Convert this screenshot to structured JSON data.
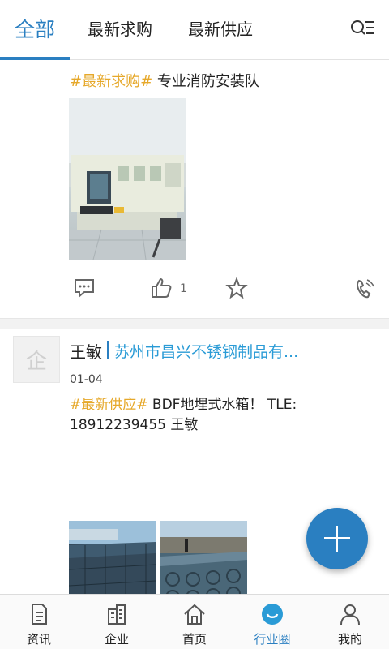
{
  "tabs": [
    {
      "label": "全部",
      "active": true
    },
    {
      "label": "最新求购",
      "active": false
    },
    {
      "label": "最新供应",
      "active": false
    }
  ],
  "posts": [
    {
      "tag": "#最新求购#",
      "text": "专业消防安装队",
      "like_count": "1"
    },
    {
      "author": "王敏",
      "company": "苏州市昌兴不锈钢制品有...",
      "date": "01-04",
      "avatar_glyph": "企",
      "tag": "#最新供应#",
      "text": "BDF地埋式水箱！   TLE: 18912239455  王敏"
    }
  ],
  "bottom_nav": [
    {
      "label": "资讯",
      "icon": "document-icon",
      "active": false
    },
    {
      "label": "企业",
      "icon": "building-icon",
      "active": false
    },
    {
      "label": "首页",
      "icon": "home-icon",
      "active": false
    },
    {
      "label": "行业圈",
      "icon": "circle-chat-icon",
      "active": true
    },
    {
      "label": "我的",
      "icon": "person-icon",
      "active": false
    }
  ],
  "colors": {
    "accent": "#2a7fc1",
    "tag": "#e6a82a",
    "company": "#2a9bd6"
  }
}
